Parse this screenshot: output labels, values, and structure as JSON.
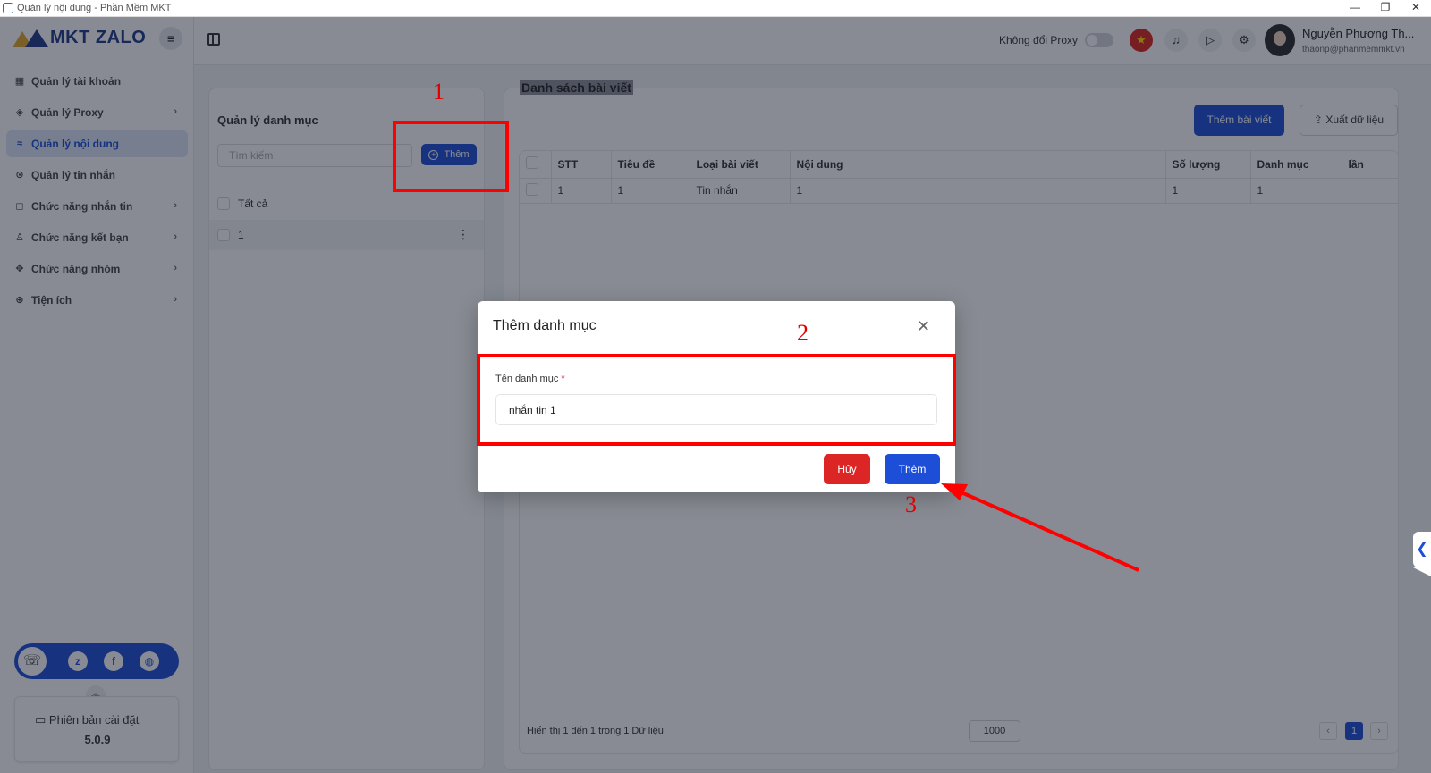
{
  "window": {
    "title": "Quản lý nội dung - Phần Mềm MKT",
    "controls": [
      "—",
      "❐",
      "✕"
    ]
  },
  "brand": {
    "name": "MKT ZALO"
  },
  "sidebar": {
    "items": [
      {
        "label": "Quản lý tài khoản",
        "icon": "grid-icon"
      },
      {
        "label": "Quản lý Proxy",
        "icon": "layers-icon"
      },
      {
        "label": "Quản lý nội dung",
        "icon": "content-icon"
      },
      {
        "label": "Quản lý tin nhắn",
        "icon": "search-message-icon"
      },
      {
        "label": "Chức năng nhắn tin",
        "icon": "chat-icon"
      },
      {
        "label": "Chức năng kết bạn",
        "icon": "add-friend-icon"
      },
      {
        "label": "Chức năng nhóm",
        "icon": "group-icon"
      },
      {
        "label": "Tiện ích",
        "icon": "utility-icon"
      }
    ],
    "version_label": "Phiên bản cài đặt",
    "version": "5.0.9"
  },
  "header": {
    "proxy_label": "Không đổi Proxy",
    "user_name": "Nguyễn Phương Th...",
    "user_email": "thaonp@phanmemmkt.vn"
  },
  "categories": {
    "title": "Quản lý danh mục",
    "search_placeholder": "Tìm kiếm",
    "add_label": "Thêm",
    "items": [
      "Tất cả",
      "1"
    ]
  },
  "posts": {
    "title": "Danh sách bài viết",
    "add_label": "Thêm bài viết",
    "export_label": "Xuất dữ liệu",
    "columns": [
      "STT",
      "Tiêu đề",
      "Loại bài viết",
      "Nội dung",
      "Số lượng",
      "Danh mục",
      "lần"
    ],
    "rows": [
      [
        "1",
        "1",
        "Tin nhắn",
        "1",
        "1",
        "1",
        ""
      ]
    ],
    "pagination_info": "Hiển thị 1 đến 1 trong 1 Dữ liệu",
    "page_size": "1000",
    "current_page": "1"
  },
  "modal": {
    "title": "Thêm danh mục",
    "field_label": "Tên danh mục",
    "field_required": "*",
    "field_value": "nhắn tin 1",
    "cancel_label": "Hủy",
    "submit_label": "Thêm"
  },
  "annotations": {
    "step1": "1",
    "step2": "2",
    "step3": "3"
  },
  "colors": {
    "primary": "#1d4ed8",
    "danger": "#dc2626",
    "annotation": "#ff0000"
  }
}
